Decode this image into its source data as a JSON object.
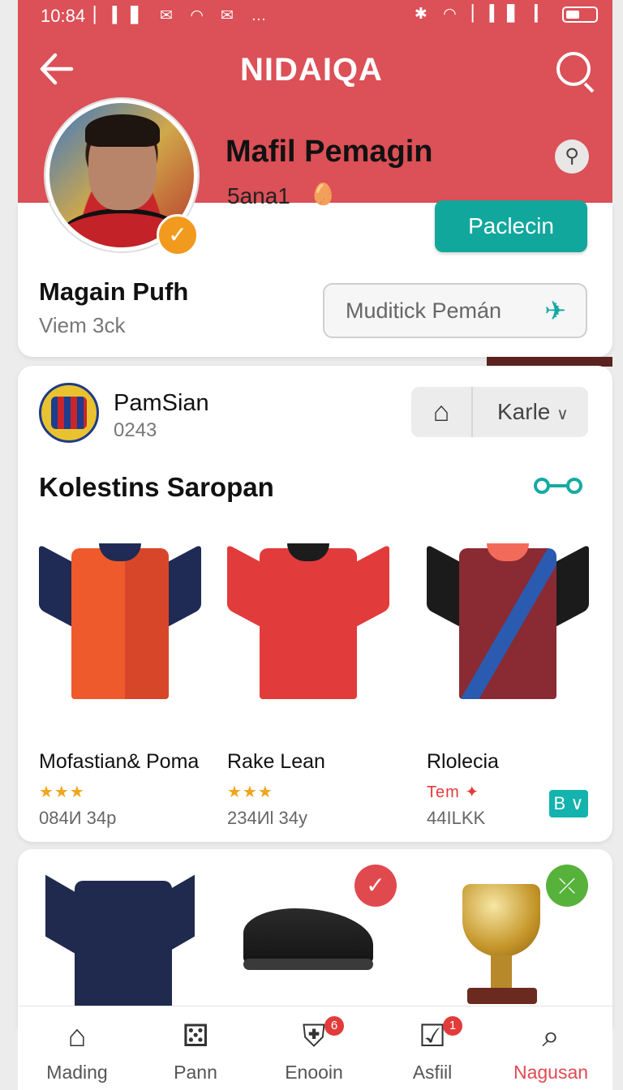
{
  "status_bar": {
    "time": "10:84",
    "left_icons": "▏▍▋ ✉ ◠ ✉ …",
    "right_icons": "✱ ◠ ▏▍▋ ▎"
  },
  "header": {
    "title": "NIDAIQA",
    "back_icon": "back-arrow-icon",
    "search_icon": "search-icon",
    "color": "#dc5057"
  },
  "profile": {
    "name": "Mafil Pemagin",
    "handle": "5ana1",
    "handle_icon": "🥚",
    "primary_button": "Paclecin",
    "player_name": "Magain Pufh",
    "player_sub": "Viem  3ck",
    "secondary_button": "Muditick Pemán",
    "secondary_icon": "✈",
    "accent": "#12a79d"
  },
  "collection": {
    "club_name": "PamSian",
    "club_code": "0243",
    "filter_select": "Karle",
    "section_title": "Kolestins Saropan",
    "section_link": "⩬→⩬",
    "products": [
      {
        "name": "Mofastian& Poma",
        "rating": "★★★",
        "price": "084И 34p",
        "primary": "#ef5a2c",
        "secondary": "#1f2a55"
      },
      {
        "name": "Rake Lean",
        "rating": "★★★",
        "price": "234Иl 34y",
        "primary": "#e23b3b",
        "secondary": "#1c1c1c"
      },
      {
        "name": "Rlolecia",
        "rating": "Tem ✦",
        "price": "44ILKK",
        "primary": "#8a2a33",
        "secondary": "#1b1b1b"
      }
    ],
    "size_badge": "B ∨"
  },
  "featured": {
    "like_icon": "✓",
    "share_icon": "⤫"
  },
  "bottom_nav": [
    {
      "label": "Mading",
      "icon": "⌂"
    },
    {
      "label": "Pann",
      "icon": "⚄"
    },
    {
      "label": "Enooin",
      "icon": "⛨",
      "badge": "6"
    },
    {
      "label": "Asfiil",
      "icon": "☑",
      "badge": "1"
    },
    {
      "label": "Nagusan",
      "icon": "⌕"
    }
  ]
}
